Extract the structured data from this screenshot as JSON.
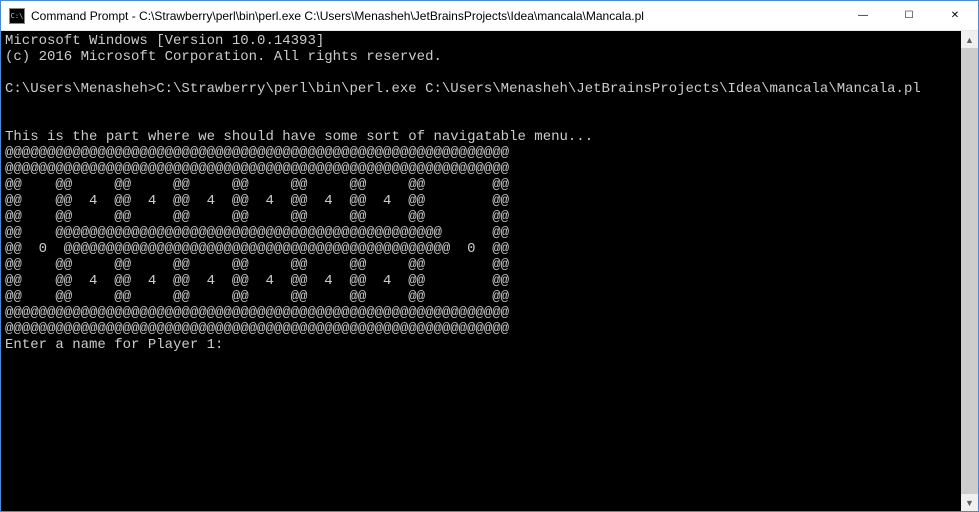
{
  "window": {
    "icon_text": "C:\\",
    "title": "Command Prompt - C:\\Strawberry\\perl\\bin\\perl.exe  C:\\Users\\Menasheh\\JetBrainsProjects\\Idea\\mancala\\Mancala.pl",
    "minimize": "—",
    "maximize": "☐",
    "close": "✕"
  },
  "console": {
    "line01": "Microsoft Windows [Version 10.0.14393]",
    "line02": "(c) 2016 Microsoft Corporation. All rights reserved.",
    "line03": "",
    "line04": "C:\\Users\\Menasheh>C:\\Strawberry\\perl\\bin\\perl.exe C:\\Users\\Menasheh\\JetBrainsProjects\\Idea\\mancala\\Mancala.pl",
    "line05": "",
    "line06": "",
    "line07": "This is the part where we should have some sort of navigatable menu...",
    "line08": "@@@@@@@@@@@@@@@@@@@@@@@@@@@@@@@@@@@@@@@@@@@@@@@@@@@@@@@@@@@@",
    "line09": "@@@@@@@@@@@@@@@@@@@@@@@@@@@@@@@@@@@@@@@@@@@@@@@@@@@@@@@@@@@@",
    "line10": "@@    @@     @@     @@     @@     @@     @@     @@        @@",
    "line11": "@@    @@  4  @@  4  @@  4  @@  4  @@  4  @@  4  @@        @@",
    "line12": "@@    @@     @@     @@     @@     @@     @@     @@        @@",
    "line13": "@@    @@@@@@@@@@@@@@@@@@@@@@@@@@@@@@@@@@@@@@@@@@@@@@      @@",
    "line14": "@@  0  @@@@@@@@@@@@@@@@@@@@@@@@@@@@@@@@@@@@@@@@@@@@@@  0  @@",
    "line15": "@@    @@     @@     @@     @@     @@     @@     @@        @@",
    "line16": "@@    @@  4  @@  4  @@  4  @@  4  @@  4  @@  4  @@        @@",
    "line17": "@@    @@     @@     @@     @@     @@     @@     @@        @@",
    "line18": "@@@@@@@@@@@@@@@@@@@@@@@@@@@@@@@@@@@@@@@@@@@@@@@@@@@@@@@@@@@@",
    "line19": "@@@@@@@@@@@@@@@@@@@@@@@@@@@@@@@@@@@@@@@@@@@@@@@@@@@@@@@@@@@@",
    "line20": "Enter a name for Player 1:"
  },
  "scrollbar": {
    "up": "▲",
    "down": "▼"
  }
}
